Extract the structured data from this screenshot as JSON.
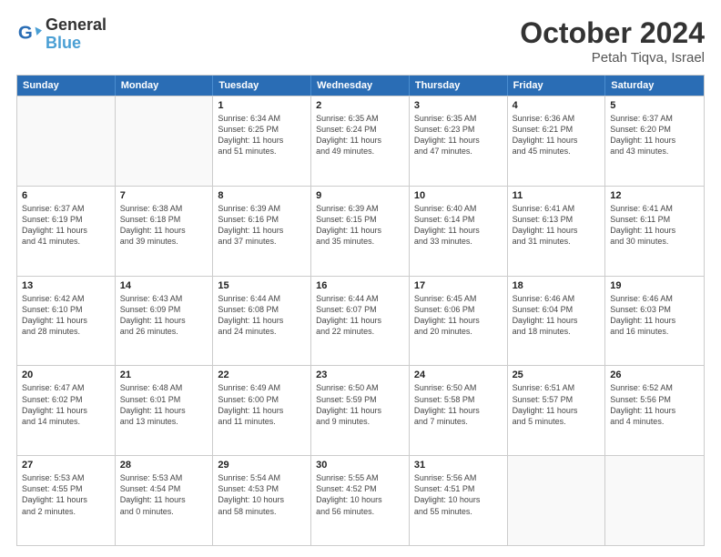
{
  "header": {
    "logo_line1": "General",
    "logo_line2": "Blue",
    "month_year": "October 2024",
    "location": "Petah Tiqva, Israel"
  },
  "weekdays": [
    "Sunday",
    "Monday",
    "Tuesday",
    "Wednesday",
    "Thursday",
    "Friday",
    "Saturday"
  ],
  "rows": [
    [
      {
        "day": "",
        "info": ""
      },
      {
        "day": "",
        "info": ""
      },
      {
        "day": "1",
        "info": "Sunrise: 6:34 AM\nSunset: 6:25 PM\nDaylight: 11 hours\nand 51 minutes."
      },
      {
        "day": "2",
        "info": "Sunrise: 6:35 AM\nSunset: 6:24 PM\nDaylight: 11 hours\nand 49 minutes."
      },
      {
        "day": "3",
        "info": "Sunrise: 6:35 AM\nSunset: 6:23 PM\nDaylight: 11 hours\nand 47 minutes."
      },
      {
        "day": "4",
        "info": "Sunrise: 6:36 AM\nSunset: 6:21 PM\nDaylight: 11 hours\nand 45 minutes."
      },
      {
        "day": "5",
        "info": "Sunrise: 6:37 AM\nSunset: 6:20 PM\nDaylight: 11 hours\nand 43 minutes."
      }
    ],
    [
      {
        "day": "6",
        "info": "Sunrise: 6:37 AM\nSunset: 6:19 PM\nDaylight: 11 hours\nand 41 minutes."
      },
      {
        "day": "7",
        "info": "Sunrise: 6:38 AM\nSunset: 6:18 PM\nDaylight: 11 hours\nand 39 minutes."
      },
      {
        "day": "8",
        "info": "Sunrise: 6:39 AM\nSunset: 6:16 PM\nDaylight: 11 hours\nand 37 minutes."
      },
      {
        "day": "9",
        "info": "Sunrise: 6:39 AM\nSunset: 6:15 PM\nDaylight: 11 hours\nand 35 minutes."
      },
      {
        "day": "10",
        "info": "Sunrise: 6:40 AM\nSunset: 6:14 PM\nDaylight: 11 hours\nand 33 minutes."
      },
      {
        "day": "11",
        "info": "Sunrise: 6:41 AM\nSunset: 6:13 PM\nDaylight: 11 hours\nand 31 minutes."
      },
      {
        "day": "12",
        "info": "Sunrise: 6:41 AM\nSunset: 6:11 PM\nDaylight: 11 hours\nand 30 minutes."
      }
    ],
    [
      {
        "day": "13",
        "info": "Sunrise: 6:42 AM\nSunset: 6:10 PM\nDaylight: 11 hours\nand 28 minutes."
      },
      {
        "day": "14",
        "info": "Sunrise: 6:43 AM\nSunset: 6:09 PM\nDaylight: 11 hours\nand 26 minutes."
      },
      {
        "day": "15",
        "info": "Sunrise: 6:44 AM\nSunset: 6:08 PM\nDaylight: 11 hours\nand 24 minutes."
      },
      {
        "day": "16",
        "info": "Sunrise: 6:44 AM\nSunset: 6:07 PM\nDaylight: 11 hours\nand 22 minutes."
      },
      {
        "day": "17",
        "info": "Sunrise: 6:45 AM\nSunset: 6:06 PM\nDaylight: 11 hours\nand 20 minutes."
      },
      {
        "day": "18",
        "info": "Sunrise: 6:46 AM\nSunset: 6:04 PM\nDaylight: 11 hours\nand 18 minutes."
      },
      {
        "day": "19",
        "info": "Sunrise: 6:46 AM\nSunset: 6:03 PM\nDaylight: 11 hours\nand 16 minutes."
      }
    ],
    [
      {
        "day": "20",
        "info": "Sunrise: 6:47 AM\nSunset: 6:02 PM\nDaylight: 11 hours\nand 14 minutes."
      },
      {
        "day": "21",
        "info": "Sunrise: 6:48 AM\nSunset: 6:01 PM\nDaylight: 11 hours\nand 13 minutes."
      },
      {
        "day": "22",
        "info": "Sunrise: 6:49 AM\nSunset: 6:00 PM\nDaylight: 11 hours\nand 11 minutes."
      },
      {
        "day": "23",
        "info": "Sunrise: 6:50 AM\nSunset: 5:59 PM\nDaylight: 11 hours\nand 9 minutes."
      },
      {
        "day": "24",
        "info": "Sunrise: 6:50 AM\nSunset: 5:58 PM\nDaylight: 11 hours\nand 7 minutes."
      },
      {
        "day": "25",
        "info": "Sunrise: 6:51 AM\nSunset: 5:57 PM\nDaylight: 11 hours\nand 5 minutes."
      },
      {
        "day": "26",
        "info": "Sunrise: 6:52 AM\nSunset: 5:56 PM\nDaylight: 11 hours\nand 4 minutes."
      }
    ],
    [
      {
        "day": "27",
        "info": "Sunrise: 5:53 AM\nSunset: 4:55 PM\nDaylight: 11 hours\nand 2 minutes."
      },
      {
        "day": "28",
        "info": "Sunrise: 5:53 AM\nSunset: 4:54 PM\nDaylight: 11 hours\nand 0 minutes."
      },
      {
        "day": "29",
        "info": "Sunrise: 5:54 AM\nSunset: 4:53 PM\nDaylight: 10 hours\nand 58 minutes."
      },
      {
        "day": "30",
        "info": "Sunrise: 5:55 AM\nSunset: 4:52 PM\nDaylight: 10 hours\nand 56 minutes."
      },
      {
        "day": "31",
        "info": "Sunrise: 5:56 AM\nSunset: 4:51 PM\nDaylight: 10 hours\nand 55 minutes."
      },
      {
        "day": "",
        "info": ""
      },
      {
        "day": "",
        "info": ""
      }
    ]
  ]
}
